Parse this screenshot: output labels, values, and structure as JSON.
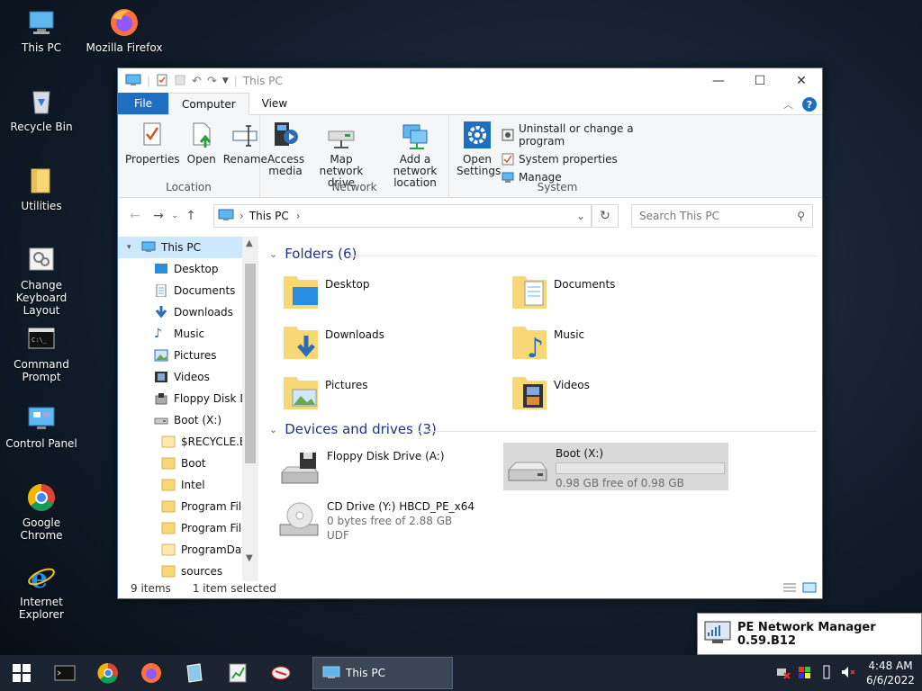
{
  "desktop": {
    "icons": [
      {
        "label": "This PC"
      },
      {
        "label": "Mozilla Firefox"
      },
      {
        "label": "Recycle Bin"
      },
      {
        "label": "Utilities"
      },
      {
        "label": "Change Keyboard Layout"
      },
      {
        "label": "Command Prompt"
      },
      {
        "label": "Control Panel"
      },
      {
        "label": "Google Chrome"
      },
      {
        "label": "Internet Explorer"
      }
    ]
  },
  "window": {
    "title": "This PC",
    "tabs": {
      "file": "File",
      "computer": "Computer",
      "view": "View"
    },
    "ribbon": {
      "location": {
        "label": "Location",
        "properties": "Properties",
        "open": "Open",
        "rename": "Rename"
      },
      "network": {
        "label": "Network",
        "access_media": "Access media",
        "map_drive": "Map network drive",
        "add_location": "Add a network location"
      },
      "system": {
        "label": "System",
        "open_settings": "Open Settings",
        "uninstall": "Uninstall or change a program",
        "system_properties": "System properties",
        "manage": "Manage"
      }
    },
    "address": {
      "path": "This PC",
      "search_placeholder": "Search This PC"
    },
    "nav": [
      {
        "label": "This PC",
        "selected": true
      },
      {
        "label": "Desktop"
      },
      {
        "label": "Documents"
      },
      {
        "label": "Downloads"
      },
      {
        "label": "Music"
      },
      {
        "label": "Pictures"
      },
      {
        "label": "Videos"
      },
      {
        "label": "Floppy Disk Dri"
      },
      {
        "label": "Boot (X:)"
      },
      {
        "label": "$RECYCLE.BIN"
      },
      {
        "label": "Boot"
      },
      {
        "label": "Intel"
      },
      {
        "label": "Program Files"
      },
      {
        "label": "Program Files"
      },
      {
        "label": "ProgramData"
      },
      {
        "label": "sources"
      }
    ],
    "folders_header": "Folders (6)",
    "folders": [
      {
        "name": "Desktop"
      },
      {
        "name": "Documents"
      },
      {
        "name": "Downloads"
      },
      {
        "name": "Music"
      },
      {
        "name": "Pictures"
      },
      {
        "name": "Videos"
      }
    ],
    "drives_header": "Devices and drives (3)",
    "drives": [
      {
        "name": "Floppy Disk Drive (A:)"
      },
      {
        "name": "Boot (X:)",
        "space": "0.98 GB free of 0.98 GB",
        "used_fraction": 0.0
      },
      {
        "name": "CD Drive (Y:) HBCD_PE_x64",
        "space": "0 bytes free of 2.88 GB",
        "fs": "UDF"
      }
    ],
    "status": {
      "items": "9 items",
      "selected": "1 item selected"
    }
  },
  "pe_network": {
    "label": "PE Network Manager 0.59.B12"
  },
  "taskbar": {
    "active_window": "This PC",
    "clock_time": "4:48 AM",
    "clock_date": "6/6/2022"
  },
  "colors": {
    "accent": "#1e6fc2",
    "selection": "#cce8ff",
    "folder": "#f8d775"
  }
}
